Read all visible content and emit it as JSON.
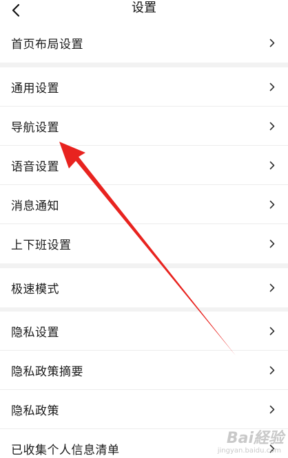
{
  "header": {
    "title": "设置",
    "back_icon": "chevron-left-icon"
  },
  "groups": [
    {
      "items": [
        {
          "label": "首页布局设置"
        }
      ]
    },
    {
      "items": [
        {
          "label": "通用设置"
        },
        {
          "label": "导航设置"
        },
        {
          "label": "语音设置"
        },
        {
          "label": "消息通知"
        },
        {
          "label": "上下班设置"
        }
      ]
    },
    {
      "items": [
        {
          "label": "极速模式"
        }
      ]
    },
    {
      "items": [
        {
          "label": "隐私设置"
        },
        {
          "label": "隐私政策摘要"
        },
        {
          "label": "隐私政策"
        },
        {
          "label": "已收集个人信息清单"
        }
      ]
    }
  ],
  "annotation": {
    "arrow_color": "#e8231f"
  },
  "watermark": {
    "main": "Bai経验",
    "sub": "jingyan.baidu.com"
  }
}
